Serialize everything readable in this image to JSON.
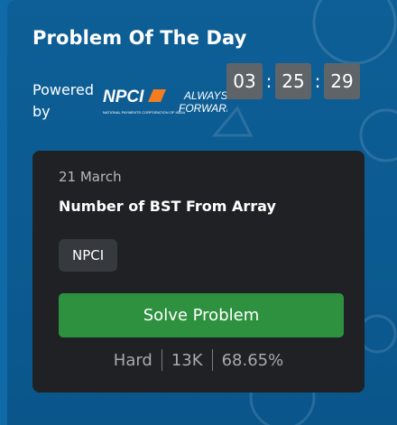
{
  "header": {
    "title": "Problem Of The Day",
    "powered_by": "Powered by",
    "sponsor_logo_text": "NPCI",
    "sponsor_tagline_line1": "ALWAYS",
    "sponsor_tagline_line2": "FORWARD",
    "sponsor_fineprint": "NATIONAL PAYMENTS CORPORATION OF INDIA"
  },
  "timer": {
    "hours": "03",
    "minutes": "25",
    "seconds": "29",
    "separator": ":"
  },
  "problem": {
    "date": "21 March",
    "name": "Number of BST From Array",
    "tag": "NPCI",
    "solve_label": "Solve Problem",
    "difficulty": "Hard",
    "submissions": "13K",
    "accuracy": "68.65%"
  },
  "colors": {
    "background": "#0f6aa7",
    "card_dark": "#1f2124",
    "solve_button": "#2e9140",
    "timer_box": "#5f6468",
    "logo_orange": "#f47c20"
  }
}
